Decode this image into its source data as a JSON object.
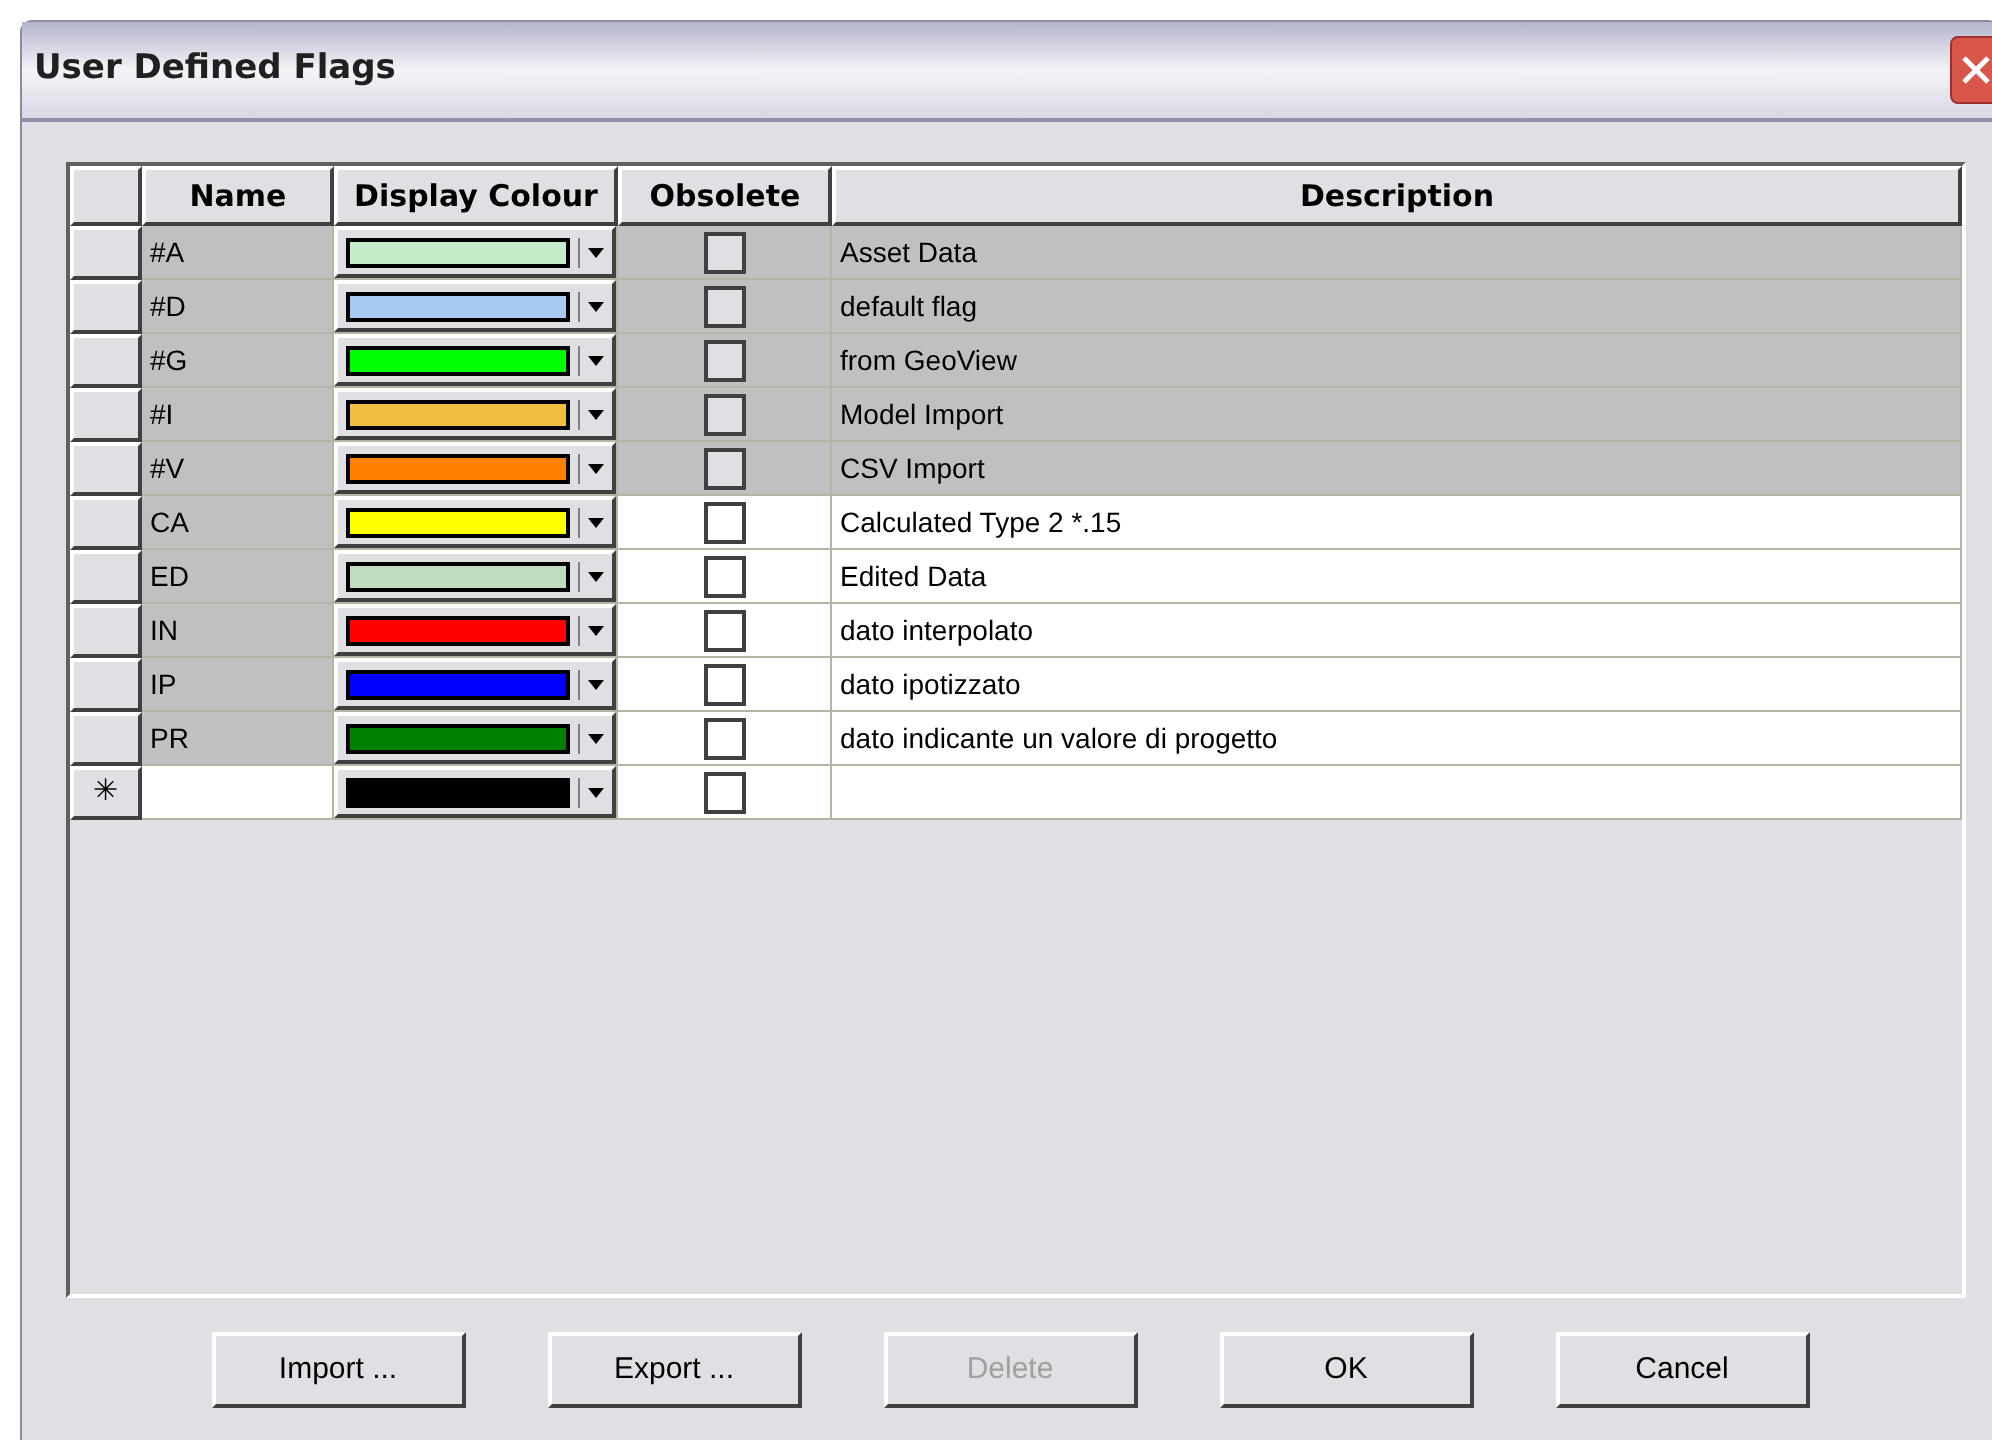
{
  "window": {
    "title": "User Defined Flags"
  },
  "table": {
    "columns": [
      "Name",
      "Display Colour",
      "Obsolete",
      "Description"
    ],
    "rows": [
      {
        "kind": "flag",
        "name": "#A",
        "color": "#c6ecc9",
        "obsolete": false,
        "locked": true,
        "description": "Asset Data"
      },
      {
        "kind": "flag",
        "name": "#D",
        "color": "#a6caf0",
        "obsolete": false,
        "locked": true,
        "description": "default flag"
      },
      {
        "kind": "flag",
        "name": "#G",
        "color": "#00ff00",
        "obsolete": false,
        "locked": true,
        "description": "from GeoView"
      },
      {
        "kind": "flag",
        "name": "#I",
        "color": "#f0be40",
        "obsolete": false,
        "locked": true,
        "description": "Model Import"
      },
      {
        "kind": "flag",
        "name": "#V",
        "color": "#ff8000",
        "obsolete": false,
        "locked": true,
        "description": "CSV Import"
      },
      {
        "kind": "flag",
        "name": "CA",
        "color": "#ffff00",
        "obsolete": false,
        "locked": false,
        "description": "Calculated Type 2 *.15"
      },
      {
        "kind": "flag",
        "name": "ED",
        "color": "#c0dcc0",
        "obsolete": false,
        "locked": false,
        "description": "Edited Data"
      },
      {
        "kind": "flag",
        "name": "IN",
        "color": "#ff0000",
        "obsolete": false,
        "locked": false,
        "description": "dato interpolato"
      },
      {
        "kind": "flag",
        "name": "IP",
        "color": "#0000ff",
        "obsolete": false,
        "locked": false,
        "description": "dato ipotizzato"
      },
      {
        "kind": "flag",
        "name": "PR",
        "color": "#008000",
        "obsolete": false,
        "locked": false,
        "description": "dato indicante un valore di progetto"
      },
      {
        "kind": "new",
        "marker": "✳",
        "color": "#000000",
        "obsolete": false
      }
    ]
  },
  "buttons": [
    {
      "label": "Import ...",
      "disabled": false
    },
    {
      "label": "Export ...",
      "disabled": false
    },
    {
      "label": "Delete",
      "disabled": true
    },
    {
      "label": "OK",
      "disabled": false
    },
    {
      "label": "Cancel",
      "disabled": false
    }
  ]
}
